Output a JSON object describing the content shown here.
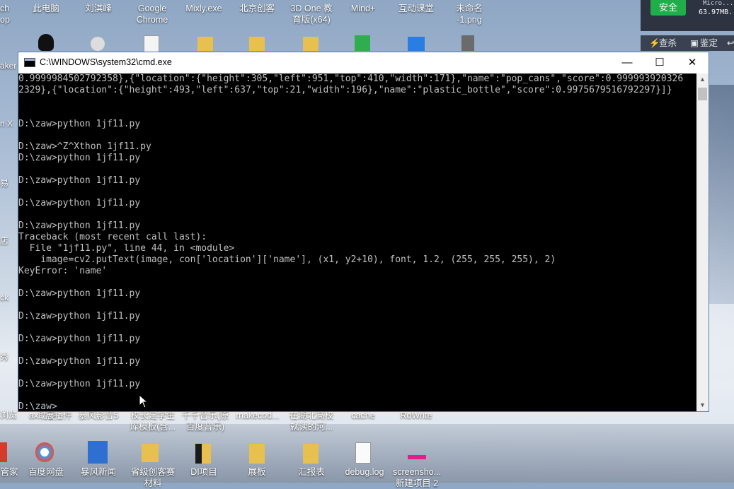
{
  "desktop": {
    "top_icons": [
      {
        "label": "ch\nop"
      },
      {
        "label": "此电脑"
      },
      {
        "label": "刘淇峰"
      },
      {
        "label": "Google\nChrome"
      },
      {
        "label": "Mixly.exe"
      },
      {
        "label": "北京创客"
      },
      {
        "label": "3D One 教\n育版(x64)"
      },
      {
        "label": "Mind+"
      },
      {
        "label": "互动课堂"
      },
      {
        "label": "未命名\n-1.png"
      }
    ],
    "left_labels": [
      "aker",
      "n X",
      "易",
      "店",
      "ck",
      "秀",
      "浏览"
    ],
    "hidden_row_labels": [
      "ax助手",
      "展播件",
      "暴风影音5",
      "校长建学生\n库模板(含...",
      "千千音乐(原\n百度音乐)",
      "makecod...",
      "在湖北高校\n就读的河...",
      "cache",
      "RoWrite"
    ],
    "bottom_icons": [
      {
        "label": "管家"
      },
      {
        "label": "百度网盘"
      },
      {
        "label": "暴风新闻"
      },
      {
        "label": "省级创客赛\n材料"
      },
      {
        "label": "DI项目"
      },
      {
        "label": "展板"
      },
      {
        "label": "汇报表"
      },
      {
        "label": "debug.log"
      },
      {
        "label": "screensho...\n新建项目 2"
      }
    ]
  },
  "widget": {
    "safe_label": "安全",
    "mem_top": "Micro...",
    "mem": "63.97MB...",
    "kill_label": "查杀",
    "guard_label": "鉴定"
  },
  "window": {
    "title": "C:\\WINDOWS\\system32\\cmd.exe",
    "minimize": "—",
    "maximize": "☐",
    "close": "✕"
  },
  "console": {
    "lines": [
      "0.9999984502792358},{\"location\":{\"height\":305,\"left\":951,\"top\":410,\"width\":171},\"name\":\"pop_cans\",\"score\":0.999993920326",
      "2329},{\"location\":{\"height\":493,\"left\":637,\"top\":21,\"width\":196},\"name\":\"plastic_bottle\",\"score\":0.9975679516792297}]}",
      "",
      "",
      "D:\\zaw>python 1jf11.py",
      "",
      "D:\\zaw>^Z^Xthon 1jf11.py",
      "D:\\zaw>python 1jf11.py",
      "",
      "D:\\zaw>python 1jf11.py",
      "",
      "D:\\zaw>python 1jf11.py",
      "",
      "D:\\zaw>python 1jf11.py",
      "Traceback (most recent call last):",
      "  File \"1jf11.py\", line 44, in <module>",
      "    image=cv2.putText(image, con['location']['name'], (x1, y2+10), font, 1.2, (255, 255, 255), 2)",
      "KeyError: 'name'",
      "",
      "D:\\zaw>python 1jf11.py",
      "",
      "D:\\zaw>python 1jf11.py",
      "",
      "D:\\zaw>python 1jf11.py",
      "",
      "D:\\zaw>python 1jf11.py",
      "",
      "D:\\zaw>python 1jf11.py",
      "",
      "D:\\zaw>"
    ]
  },
  "colors": {
    "console_bg": "#000000",
    "console_fg": "#c0c0c0",
    "safe_green": "#1fae4a"
  }
}
